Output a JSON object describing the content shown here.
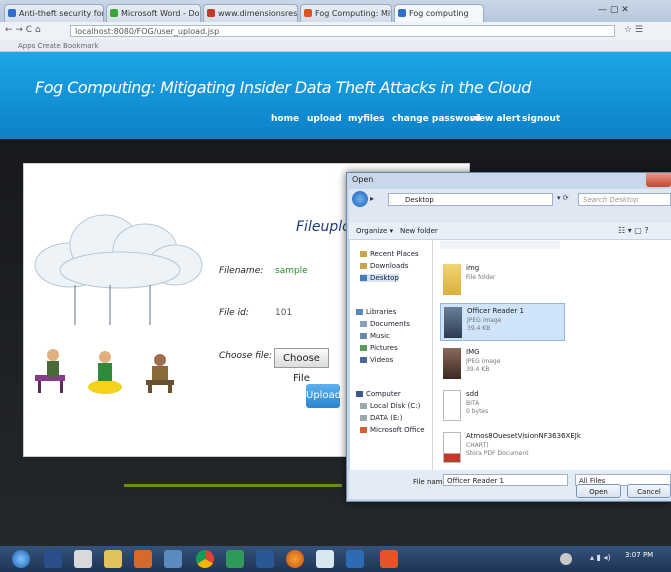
{
  "browser": {
    "tabs": [
      {
        "label": "Anti-theft security for v...",
        "color": "#2f6ecc"
      },
      {
        "label": "Microsoft Word - Docum...",
        "color": "#3aa63a"
      },
      {
        "label": "www.dimensionsresearch...",
        "color": "#c0392b"
      },
      {
        "label": "Fog Computing: Mitigati...",
        "color": "#d9541e"
      },
      {
        "label": "Fog computing",
        "color": "#2f6ecc"
      }
    ],
    "url": "localhost:8080/FOG/user_upload.jsp",
    "bookmarks": "Apps  Create Bookmark"
  },
  "site": {
    "title": "Fog Computing: Mitigating Insider Data Theft Attacks in the Cloud",
    "nav": [
      "home",
      "upload",
      "myfiles",
      "change password",
      "view alert",
      "signout"
    ]
  },
  "upload_form": {
    "title": "Fileuplo",
    "filename_label": "Filename:",
    "filename_value": "sample",
    "fileid_label": "File id:",
    "fileid_value": "101",
    "choose_label": "Choose file:",
    "choose_button": "Choose File",
    "upload_button": "Upload"
  },
  "dialog": {
    "title": "Open",
    "path": "Desktop",
    "search_placeholder": "Search Desktop",
    "organize": "Organize ▾",
    "new_folder": "New folder",
    "tree": [
      "Recent Places",
      "Downloads",
      "Desktop",
      "",
      "Libraries",
      "Documents",
      "Music",
      "Pictures",
      "Videos",
      "",
      "Computer",
      "Local Disk (C:)",
      "DATA (E:)",
      "Microsoft Office"
    ],
    "files": [
      {
        "name": "img",
        "sub1": "File folder",
        "sub2": ""
      },
      {
        "name": "Officer Reader 1",
        "sub1": "JPEG image",
        "sub2": "39.4 KB"
      },
      {
        "name": "IMG",
        "sub1": "JPEG image",
        "sub2": "39.4 KB"
      },
      {
        "name": "sdd",
        "sub1": "BITA",
        "sub2": "0 bytes"
      },
      {
        "name": "Atmos8OuesetVisionNF3636XEJk",
        "sub1": "CHART)",
        "sub2": "Stora PDF Document"
      }
    ],
    "filename_label": "File name:",
    "filename_value": "Officer Reader 1",
    "filetype": "All Files",
    "open_button": "Open",
    "cancel_button": "Cancel"
  },
  "taskbar": {
    "icons": [
      "start",
      "powershell",
      "explorer",
      "folder",
      "media",
      "java",
      "chrome",
      "word",
      "firefox",
      "paint",
      "teamviewer",
      "vlc",
      "winrar"
    ],
    "clock": "3:07 PM"
  }
}
